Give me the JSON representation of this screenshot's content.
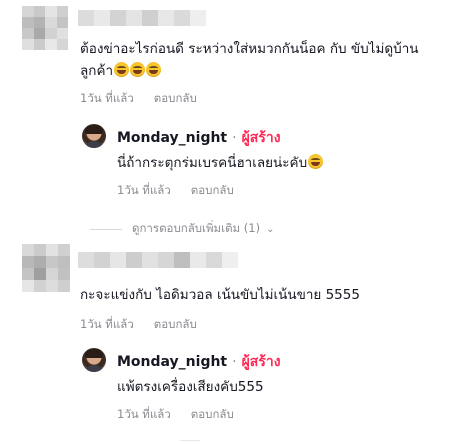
{
  "colors": {
    "creator_badge": "#fe2c55",
    "meta_text": "#8a8b91",
    "text": "#161823"
  },
  "comments": [
    {
      "text": "ต้องข่าอะไรก่อนดี ระหว่างใส่หมวกกันน็อค กับ ขับไม่ดูบ้าน",
      "text_line2": "ลูกค้า",
      "time": "1วัน ที่แล้ว",
      "reply_label": "ตอบกลับ",
      "reply": {
        "username": "Monday_night",
        "dot": "·",
        "badge": "ผู้สร้าง",
        "text": "นี่ถ้ากระตุกร่มเบรคนี่ฮาเลยน่ะคับ",
        "time": "1วัน ที่แล้ว",
        "reply_label": "ตอบกลับ"
      },
      "more_replies": "ดูการตอบกลับเพิ่มเติม (1)"
    },
    {
      "text": "กะจะแข่งกับ ไอดิมวอล เน้นขับไม่เน้นขาย 5555",
      "time": "1วัน ที่แล้ว",
      "reply_label": "ตอบกลับ",
      "reply": {
        "username": "Monday_night",
        "dot": "·",
        "badge": "ผู้สร้าง",
        "text": "แพ้ตรงเครื่องเสียงคับ555",
        "time": "1วัน ที่แล้ว",
        "reply_label": "ตอบกลับ"
      }
    }
  ],
  "icons": {
    "emoji": "grinning-face-with-tears-icon",
    "chevron": "chevron-down-icon"
  }
}
